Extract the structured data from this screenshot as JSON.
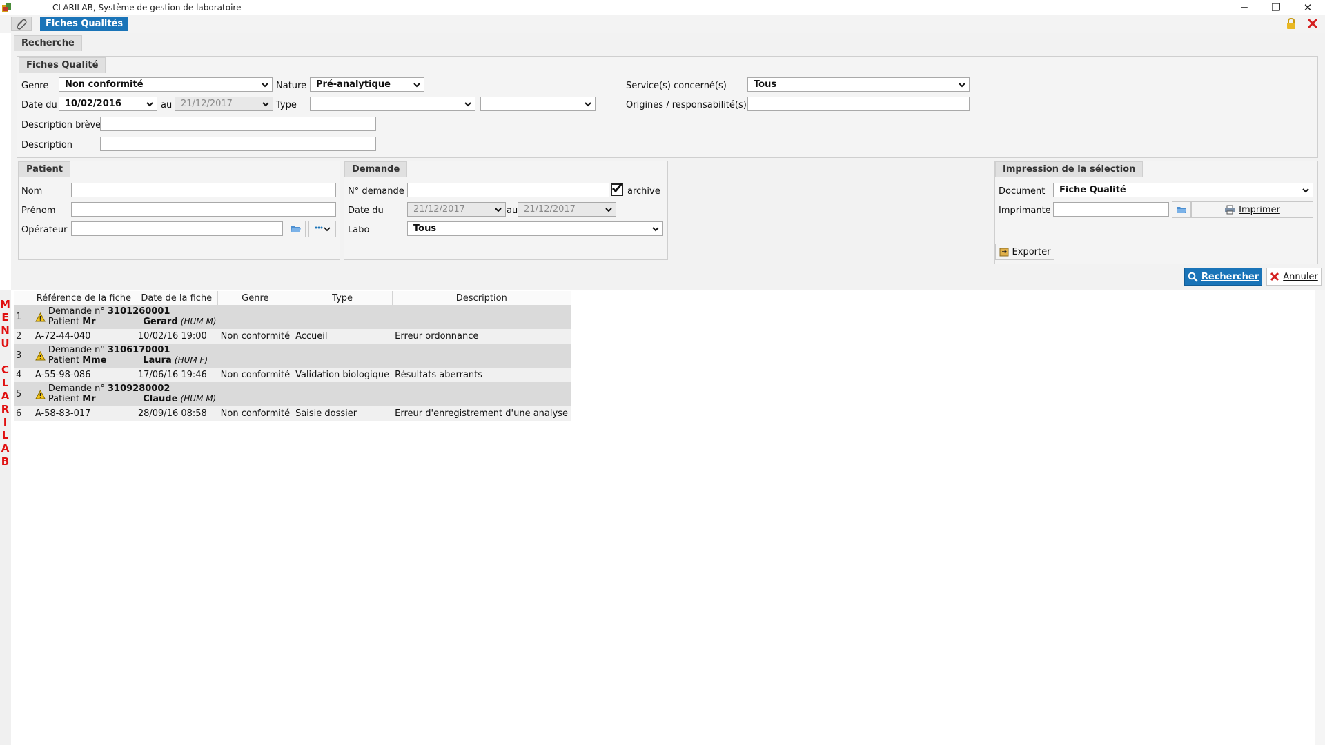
{
  "window": {
    "title": "CLARILAB, Système de gestion de laboratoire",
    "minimize": "─",
    "restore": "❐",
    "close": "✕"
  },
  "toolbar": {
    "tab_label": "Fiches Qualités"
  },
  "search": {
    "tab_label": "Recherche",
    "fiches": {
      "header": "Fiches Qualité",
      "genre_label": "Genre",
      "genre_value": "Non conformité",
      "nature_label": "Nature",
      "nature_value": "Pré-analytique",
      "services_label": "Service(s) concerné(s)",
      "services_value": "Tous",
      "date_du_label": "Date du",
      "date_du_value": "10/02/2016",
      "au_label": "au",
      "date_au_value": "21/12/2017",
      "type_label": "Type",
      "type_value": "",
      "type2_value": "",
      "origines_label": "Origines / responsabilité(s)",
      "origines_value": "",
      "desc_breve_label": "Description brève",
      "desc_breve_value": "",
      "description_label": "Description",
      "description_value": ""
    },
    "patient": {
      "header": "Patient",
      "nom_label": "Nom",
      "prenom_label": "Prénom",
      "operateur_label": "Opérateur",
      "nom_value": "",
      "prenom_value": "",
      "operateur_value": ""
    },
    "demande": {
      "header": "Demande",
      "num_label": "N° demande",
      "num_value": "",
      "archive_label": "archive",
      "archive_checked": true,
      "date_du_label": "Date du",
      "date_du_value": "21/12/2017",
      "au_label": "au",
      "date_au_value": "21/12/2017",
      "labo_label": "Labo",
      "labo_value": "Tous"
    },
    "impression": {
      "header": "Impression de la sélection",
      "document_label": "Document",
      "document_value": "Fiche Qualité",
      "imprimante_label": "Imprimante",
      "imprimante_value": "",
      "imprimer_label": "Imprimer",
      "exporter_label": "Exporter"
    },
    "rechercher_label": "Rechercher",
    "annuler_label": "Annuler"
  },
  "side_menu": "MENU CLARILAB",
  "results": {
    "columns": [
      "Référence de la fiche",
      "Date de la fiche",
      "Genre",
      "Type",
      "Description"
    ],
    "rows": [
      {
        "num": "1",
        "group": true,
        "demande_label": "Demande n°",
        "demande_num": "3101260001",
        "patient_label": "Patient",
        "civilite": "Mr",
        "prenom": "Gerard",
        "info": "(HUM M)"
      },
      {
        "num": "2",
        "group": false,
        "ref": "A-72-44-040",
        "date": "10/02/16 19:00",
        "genre": "Non conformité",
        "type": "Accueil",
        "description": "Erreur ordonnance"
      },
      {
        "num": "3",
        "group": true,
        "demande_label": "Demande n°",
        "demande_num": "3106170001",
        "patient_label": "Patient",
        "civilite": "Mme",
        "prenom": "Laura",
        "info": "(HUM F)"
      },
      {
        "num": "4",
        "group": false,
        "ref": "A-55-98-086",
        "date": "17/06/16 19:46",
        "genre": "Non conformité",
        "type": "Validation biologique",
        "description": "Résultats aberrants"
      },
      {
        "num": "5",
        "group": true,
        "demande_label": "Demande n°",
        "demande_num": "3109280002",
        "patient_label": "Patient",
        "civilite": "Mr",
        "prenom": "Claude",
        "info": "(HUM M)"
      },
      {
        "num": "6",
        "group": false,
        "ref": "A-58-83-017",
        "date": "28/09/16 08:58",
        "genre": "Non conformité",
        "type": "Saisie dossier",
        "description": "Erreur d'enregistrement d'une analyse"
      }
    ]
  },
  "colors": {
    "accent": "#1a74b8",
    "menu_red": "#e01010",
    "group_row": "#dadada",
    "data_row": "#f0f0f0"
  }
}
